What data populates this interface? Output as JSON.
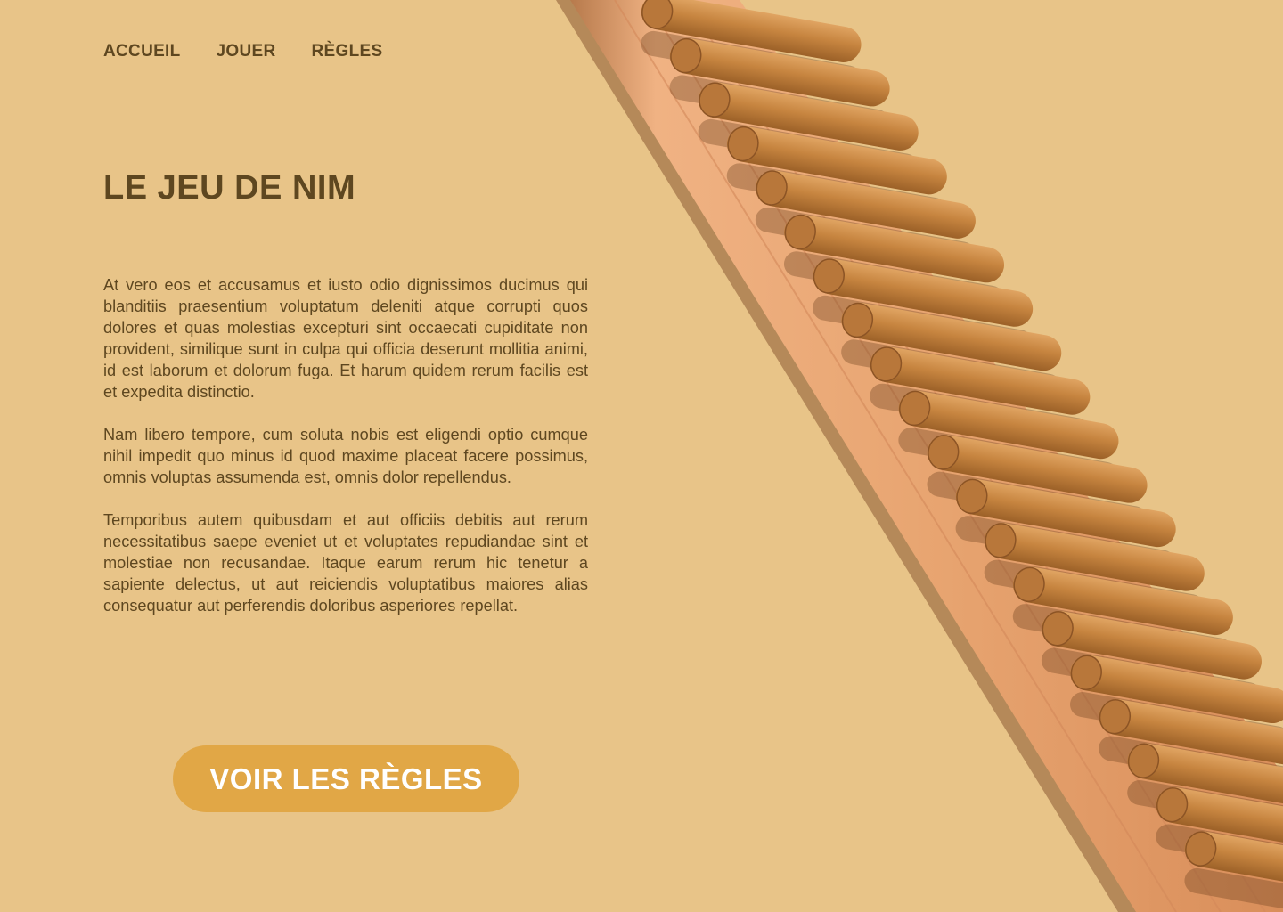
{
  "nav": {
    "items": [
      {
        "label": "ACCUEIL"
      },
      {
        "label": "JOUER"
      },
      {
        "label": "RÈGLES"
      }
    ]
  },
  "hero": {
    "title": "LE JEU DE NIM",
    "paragraphs": [
      "At vero eos et accusamus et iusto odio dignissimos ducimus qui blanditiis praesentium voluptatum deleniti atque corrupti quos dolores et quas molestias excepturi sint occaecati cupiditate non provident, similique sunt in culpa qui officia deserunt mollitia animi, id est laborum et dolorum fuga. Et harum quidem rerum facilis est et expedita distinctio.",
      "Nam libero tempore, cum soluta nobis est eligendi optio cumque nihil impedit quo minus id quod maxime placeat facere possimus, omnis voluptas assumenda est, omnis dolor repellendus.",
      "Temporibus autem quibusdam et aut officiis debitis aut rerum necessitatibus saepe eveniet ut et voluptates repudiandae sint et molestiae non recusandae. Itaque earum rerum hic tenetur a sapiente delectus, ut aut reiciendis voluptatibus maiores alias consequatur aut perferendis doloribus asperiores repellat."
    ],
    "cta_label": "VOIR LES RÈGLES"
  },
  "image": {
    "subject": "wooden-nim-board-with-sticks",
    "stick_count": 20
  },
  "colors": {
    "background": "#e8c488",
    "text": "#5e4720",
    "button": "#e1a746",
    "button_text": "#ffffff",
    "board_wood": "#e9a873",
    "stick_wood": "#c7853f"
  }
}
